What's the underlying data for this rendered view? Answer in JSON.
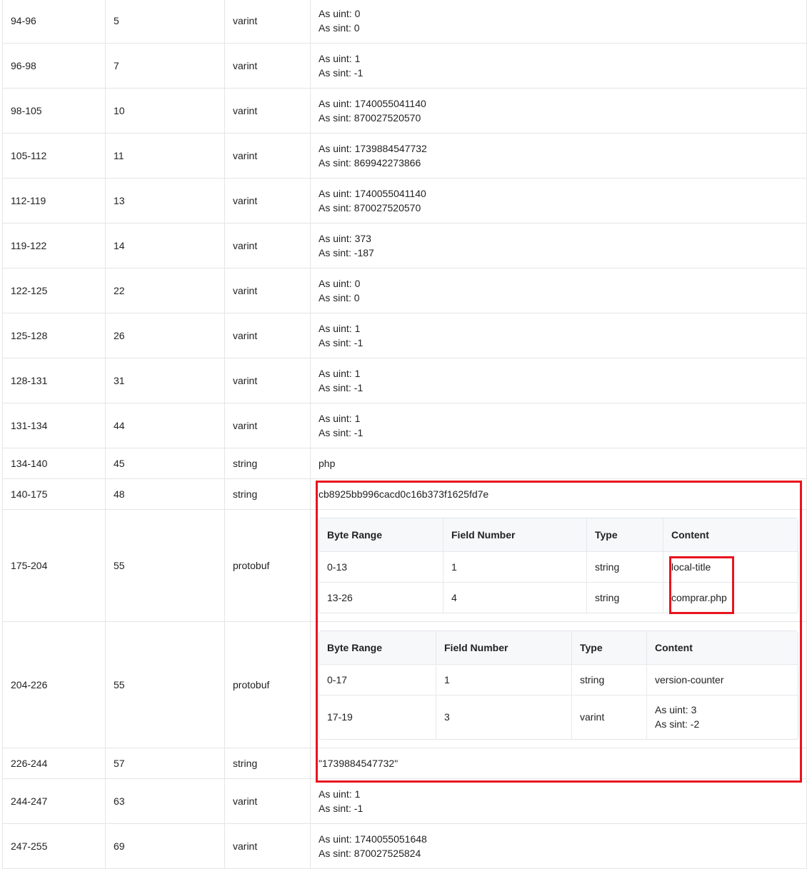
{
  "rows_top": [
    {
      "range": "94-96",
      "field": "5",
      "type": "varint",
      "uint": "As uint: 0",
      "sint": "As sint: 0"
    },
    {
      "range": "96-98",
      "field": "7",
      "type": "varint",
      "uint": "As uint: 1",
      "sint": "As sint: -1"
    },
    {
      "range": "98-105",
      "field": "10",
      "type": "varint",
      "uint": "As uint: 1740055041140",
      "sint": "As sint: 870027520570"
    },
    {
      "range": "105-112",
      "field": "11",
      "type": "varint",
      "uint": "As uint: 1739884547732",
      "sint": "As sint: 869942273866"
    },
    {
      "range": "112-119",
      "field": "13",
      "type": "varint",
      "uint": "As uint: 1740055041140",
      "sint": "As sint: 870027520570"
    },
    {
      "range": "119-122",
      "field": "14",
      "type": "varint",
      "uint": "As uint: 373",
      "sint": "As sint: -187"
    },
    {
      "range": "122-125",
      "field": "22",
      "type": "varint",
      "uint": "As uint: 0",
      "sint": "As sint: 0"
    },
    {
      "range": "125-128",
      "field": "26",
      "type": "varint",
      "uint": "As uint: 1",
      "sint": "As sint: -1"
    },
    {
      "range": "128-131",
      "field": "31",
      "type": "varint",
      "uint": "As uint: 1",
      "sint": "As sint: -1"
    },
    {
      "range": "131-134",
      "field": "44",
      "type": "varint",
      "uint": "As uint: 1",
      "sint": "As sint: -1"
    }
  ],
  "row_134": {
    "range": "134-140",
    "field": "45",
    "type": "string",
    "content": "php"
  },
  "row_140": {
    "range": "140-175",
    "field": "48",
    "type": "string",
    "content": "cb8925bb996cacd0c16b373f1625fd7e"
  },
  "row_175": {
    "range": "175-204",
    "field": "55",
    "type": "protobuf",
    "headers": [
      "Byte Range",
      "Field Number",
      "Type",
      "Content"
    ],
    "rows": [
      {
        "range": "0-13",
        "field": "1",
        "type": "string",
        "content": "local-title"
      },
      {
        "range": "13-26",
        "field": "4",
        "type": "string",
        "content": "comprar.php"
      }
    ]
  },
  "row_204": {
    "range": "204-226",
    "field": "55",
    "type": "protobuf",
    "headers": [
      "Byte Range",
      "Field Number",
      "Type",
      "Content"
    ],
    "rows": [
      {
        "range": "0-17",
        "field": "1",
        "type": "string",
        "content": "version-counter"
      },
      {
        "range": "17-19",
        "field": "3",
        "type": "varint",
        "uint": "As uint: 3",
        "sint": "As sint: -2"
      }
    ]
  },
  "row_226": {
    "range": "226-244",
    "field": "57",
    "type": "string",
    "content": "\"1739884547732\""
  },
  "rows_bottom": [
    {
      "range": "244-247",
      "field": "63",
      "type": "varint",
      "uint": "As uint: 1",
      "sint": "As sint: -1"
    },
    {
      "range": "247-255",
      "field": "69",
      "type": "varint",
      "uint": "As uint: 1740055051648",
      "sint": "As sint: 870027525824"
    }
  ],
  "colors": {
    "highlight": "#e8141f",
    "border": "#e5e5e5",
    "header_bg": "#f6f8fa"
  }
}
